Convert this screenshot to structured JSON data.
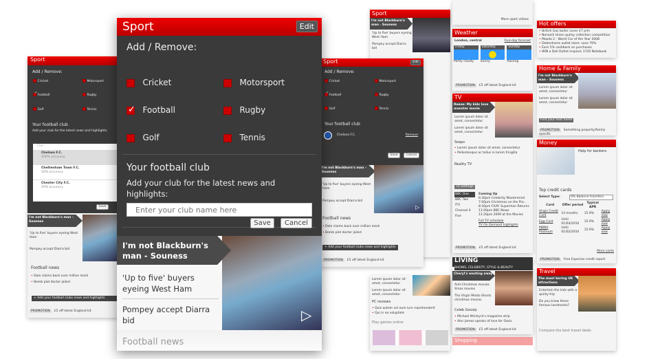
{
  "main": {
    "title": "Sport",
    "edit": "Edit",
    "add_remove": "Add / Remove:",
    "sports": [
      {
        "label": "Cricket",
        "checked": false
      },
      {
        "label": "Motorsport",
        "checked": false
      },
      {
        "label": "Football",
        "checked": true
      },
      {
        "label": "Rugby",
        "checked": false
      },
      {
        "label": "Golf",
        "checked": false
      },
      {
        "label": "Tennis",
        "checked": false
      }
    ],
    "club_title": "Your football club",
    "club_desc": "Add your club for the latest news and highlights:",
    "club_placeholder": "Enter your club name here",
    "save": "Save",
    "cancel": "Cancel",
    "headline": "I'm not Blackburn's man - Souness",
    "story1": "'Up to five' buyers eyeing West Ham",
    "story2": "Pompey accept Diarra bid",
    "next_section": "Football news"
  },
  "left": {
    "title": "Sport",
    "search_value": "Che",
    "suggestions": [
      {
        "name": "Chelsea F.C.",
        "accuracy": "100% accuracy"
      },
      {
        "name": "Cheltenham Town F.C.",
        "accuracy": "50% accuracy"
      },
      {
        "name": "Chester City F.C.",
        "accuracy": "20% accuracy"
      }
    ],
    "football_news": "Football news",
    "news": [
      "Dole claims back over million mark",
      "Bomb plot doctor jailed"
    ],
    "add_club_news": "+ Add your football clubs news and highlights",
    "promo_tag": "PROMOTION",
    "promo_text": "£5 off latest England kit"
  },
  "right": {
    "title": "Sport",
    "edit": "Edit",
    "selected_club": "Chelsea F.C.",
    "remove": "Remove"
  },
  "bg": {
    "weather": {
      "title": "Weather",
      "location": "London, central",
      "forecast_link": "Five-day forecast",
      "days": [
        {
          "day": "Friday",
          "desc": "Partly cloudy"
        },
        {
          "day": "Saturday",
          "desc": "Sunny"
        },
        {
          "day": "Sunday",
          "desc": "Raining"
        }
      ]
    },
    "more_videos": "More sport videos",
    "tv": {
      "title": "TV",
      "headline": "Reese: My kids love monster movie",
      "lorem": "Lorem ipsum dolor sit amet, consectetur",
      "soaps": "Soaps",
      "soap_items": [
        "Lorem ipsum dolor sit amet, consectetur",
        "Pellentesque ac tellus in lorem fringilla"
      ],
      "reality": "Reality TV",
      "settings": "TV Settings",
      "channels": [
        "BBC One",
        "BBC Two",
        "ITV",
        "Channel 4",
        "Five"
      ],
      "coming_up": "Coming Up",
      "schedule": [
        "6:30pm Celebrity Mastermind",
        "7:00pm Christmas on the Pro...",
        "8:30pm FILM: Superman Returns",
        "11:00pm BBC News",
        "11:20pm 2009 at the Movies"
      ],
      "full_schedule": "Full TV schedule",
      "on_demand": "TV On Demand highlights"
    },
    "living": {
      "title": "LIVING",
      "subtitle": "SHOWS, CELEBRITY, STYLE & BEAUTY",
      "headline": "Cheryl's wasting away",
      "items": [
        "Anti-Christmas movies Xmas movies",
        "The Virgin Media Shorts christmas movies"
      ],
      "gossip": "Celeb Gossip",
      "gossip_items": [
        "Michael McIntyre's magazine strip",
        "Alec James speaks of love for Oasis"
      ]
    },
    "pc": {
      "title": "PC reviews",
      "items": [
        "Quis autem vel eum iure reprehenderit",
        "Qui in ea voluptate"
      ],
      "games": "Play games online"
    },
    "hot": {
      "title": "Hot offers",
      "items": [
        "British Gas boiler cover £7 p/m",
        "Norwich Union quirky collection competition",
        "Mazda 2 - World Car of the Year 2008",
        "Debenhams outlet store: save 70%",
        "Earn 5% cashback on purchases",
        "WIN a Dell Outlet Inspiron 1720 Notebook"
      ]
    },
    "home": {
      "title": "Home & Family",
      "headline": "I'm not Blackburn's man - Souness",
      "find_home": "Find your next home",
      "promo": "Something property/family specific"
    },
    "money": {
      "title": "Money",
      "headline": "Help for bankers",
      "cards_title": "Top credit cards",
      "select_label": "Select Type:",
      "select_value": "0% Balance transfers",
      "cols": [
        "Card",
        "Offer period",
        "Typical APR"
      ],
      "rows": [
        [
          "Virgin Credit Card",
          "14 months",
          "15.9%"
        ],
        [
          "Egg Card",
          "Until 01/04/2010",
          "15.9%"
        ],
        [
          "MBNA Platinum",
          "Until 01/02/2010",
          "15.9%"
        ]
      ],
      "apply": "Apply now",
      "more": "More cards",
      "promo": "Free Experian credit report"
    },
    "travel": {
      "title": "Travel",
      "headline": "The most boring UK attractions",
      "items": [
        "Entertain the kids with a quirky trip",
        "Do you know these famous landmarks?"
      ],
      "compare": "Compare the best travel deals"
    },
    "shopping": "Shopping"
  },
  "colors": {
    "brand_red": "#cc0000",
    "panel_dark": "#3a3a3a"
  }
}
